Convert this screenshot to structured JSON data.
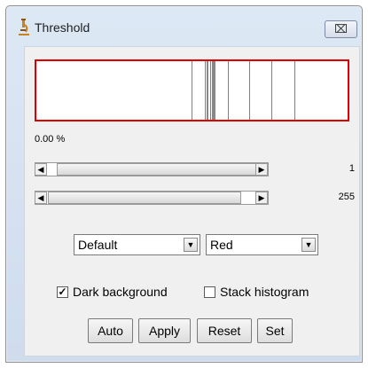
{
  "window": {
    "title": "Threshold",
    "close_symbol": "⌧"
  },
  "histogram": {
    "border_color": "#e00000"
  },
  "percentage": "0.00 %",
  "sliders": [
    {
      "value": "1",
      "min_value": 0,
      "max_value": 255
    },
    {
      "value": "255",
      "min_value": 0,
      "max_value": 255
    }
  ],
  "method_select": {
    "selected": "Default"
  },
  "display_select": {
    "selected": "Red"
  },
  "options": {
    "dark_background": {
      "label": "Dark background",
      "checked": true,
      "mark": "✓"
    },
    "stack_histogram": {
      "label": "Stack histogram",
      "checked": false,
      "mark": ""
    }
  },
  "buttons": {
    "auto": "Auto",
    "apply": "Apply",
    "reset": "Reset",
    "set": "Set"
  },
  "arrows": {
    "left": "◀",
    "right": "▶",
    "down": "▼"
  }
}
